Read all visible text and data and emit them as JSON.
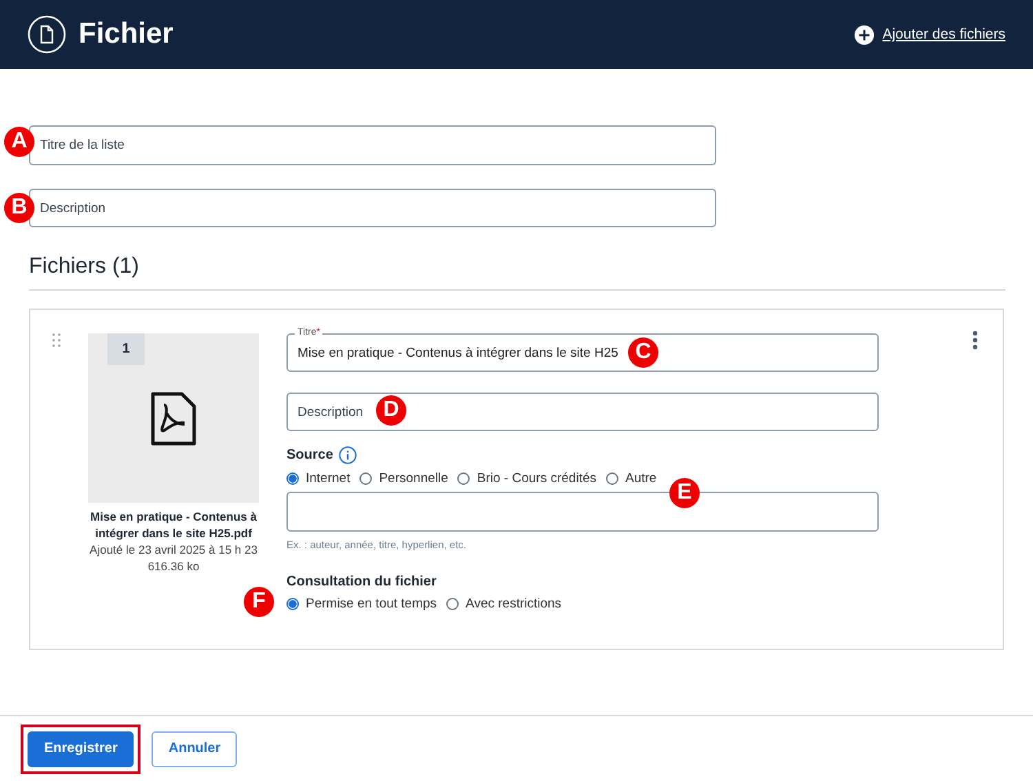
{
  "header": {
    "title": "Fichier",
    "action": "Ajouter des fichiers"
  },
  "list_title": {
    "placeholder": "Titre de la liste"
  },
  "list_description": {
    "placeholder": "Description"
  },
  "files_heading": "Fichiers (1)",
  "file": {
    "number": "1",
    "name": "Mise en pratique - Contenus à intégrer dans le site H25.pdf",
    "added": "Ajouté le 23 avril 2025 à 15 h 23",
    "size": "616.36 ko",
    "title_label": "Titre",
    "required_mark": "*",
    "title_value": "Mise en pratique - Contenus à intégrer dans le site H25",
    "description": {
      "placeholder": "Description"
    },
    "source_label": "Source",
    "source_options": [
      {
        "label": "Internet",
        "selected": true
      },
      {
        "label": "Personnelle",
        "selected": false
      },
      {
        "label": "Brio - Cours crédités",
        "selected": false
      },
      {
        "label": "Autre",
        "selected": false
      }
    ],
    "source_hint": "Ex. : auteur, année, titre, hyperlien, etc.",
    "access_label": "Consultation du fichier",
    "access_options": [
      {
        "label": "Permise en tout temps",
        "selected": true
      },
      {
        "label": "Avec restrictions",
        "selected": false
      }
    ]
  },
  "buttons": [
    {
      "label": "Enregistrer",
      "kind": "primary",
      "highlighted": true
    },
    {
      "label": "Annuler",
      "kind": "secondary",
      "highlighted": false
    }
  ],
  "markers": [
    {
      "label": "A"
    },
    {
      "label": "B"
    },
    {
      "label": "C"
    },
    {
      "label": "D"
    },
    {
      "label": "E"
    },
    {
      "label": "F"
    }
  ]
}
